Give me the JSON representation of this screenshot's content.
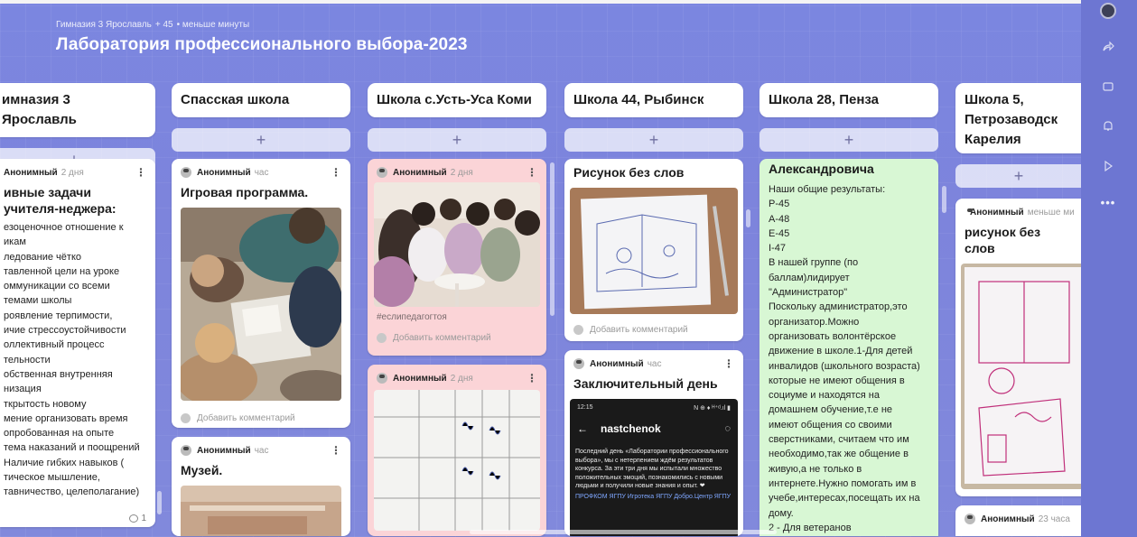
{
  "board": {
    "org": "Гимназия 3 Ярославль",
    "likes": "+ 45",
    "age": "• меньше минуты",
    "title": "Лаборатория профессионального выбора-2023"
  },
  "columns": [
    {
      "title": "имназия 3 Ярославль"
    },
    {
      "title": "Спасская школа"
    },
    {
      "title": "Школа с.Усть-Уса Коми"
    },
    {
      "title": "Школа 44, Рыбинск"
    },
    {
      "title": "Школа 28, Пенза"
    },
    {
      "title": "Школа 5, Петрозаводск Карелия"
    }
  ],
  "add_label": "+",
  "comment_placeholder": "Добавить комментарий",
  "more_glyph": "⋮",
  "cards": {
    "c1": {
      "author": "Анонимный",
      "time": "2 дня",
      "title": "ивные задачи учителя-неджера:",
      "lines": [
        "езоценочное отношение к",
        "икам",
        "ледование чётко",
        "тавленной цели на уроке",
        "оммуникации со всеми",
        "темами школы",
        "роявление терпимости,",
        "ичие стрессоустойчивости",
        "оллективный процесс",
        "тельности",
        "обственная внутренняя",
        "низация",
        "ткрытость новому",
        "мение организовать время",
        "опробованная на опыте",
        "тема наказаний и поощрений",
        "Наличие гибких навыков (",
        "тическое мышление,",
        "тавничество, целеполагание)"
      ],
      "comments": "1"
    },
    "c2": {
      "author": "Анонимный",
      "time": "час",
      "title": "Игровая программа."
    },
    "c3": {
      "author": "Анонимный",
      "time": "час",
      "title": "Музей."
    },
    "c4": {
      "author": "Анонимный",
      "time": "2 дня",
      "tag": "#еслипедагогтоя"
    },
    "c5": {
      "author": "Анонимный",
      "time": "2 дня"
    },
    "c6": {
      "title": "Рисунок без слов"
    },
    "c7": {
      "author": "Анонимный",
      "time": "час",
      "title": "Заключительный день",
      "phone": {
        "clock": "12:15",
        "status": "N ⊕ ♦ ᴴ⁺ᵈ.ıl ▮",
        "username": "nastchenok",
        "post": "Последний день «Лаборатории профессионального выбора», мы с нетерпением ждём результатов конкурса. За эти три дня мы испытали множество положительных эмоций, познакомились с новыми людьми и получили новые знания и опыт. ❤",
        "links": "ПРОФКОМ ЯГПУ Игротека ЯГПУ Добро.Центр ЯГПУ"
      }
    },
    "c8": {
      "title": "Александровича",
      "lines": [
        "Наши общие результаты:",
        "Р-45",
        "А-48",
        "Е-45",
        "I-47",
        "В нашей группе (по",
        "баллам)лидирует",
        "\"Администратор\"",
        "Поскольку администратор,это",
        "организатор.Можно",
        "организовать волонтёрское",
        "движение в школе.1-Для детей",
        "инвалидов (школьного возраста)",
        "которые не имеют общения в",
        "социуме и находятся на",
        "домашнем обучение,т.е не",
        "имеют общения со своими",
        "сверстниками, считаем что им",
        "необходимо,так же общение в",
        "живую,а не только в",
        "интернете.Нужно помогать им в",
        "учебе,интересах,посещать их на",
        "дому.",
        "2 - Для ветеранов"
      ]
    },
    "c9": {
      "author": "Анонимный",
      "time": "меньше ми",
      "title": "рисунок без слов"
    },
    "c10": {
      "author": "Анонимный",
      "time": "23 часа"
    }
  },
  "sidebar_icons": [
    "avatar",
    "share-icon",
    "copy-icon",
    "bell-icon",
    "play-icon",
    "more-icon"
  ],
  "colors": {
    "board_bg": "#7d85dd",
    "pink_card": "#fbd4d7",
    "green_card": "#d8f7d4",
    "sidebar": "#6d76d2"
  }
}
